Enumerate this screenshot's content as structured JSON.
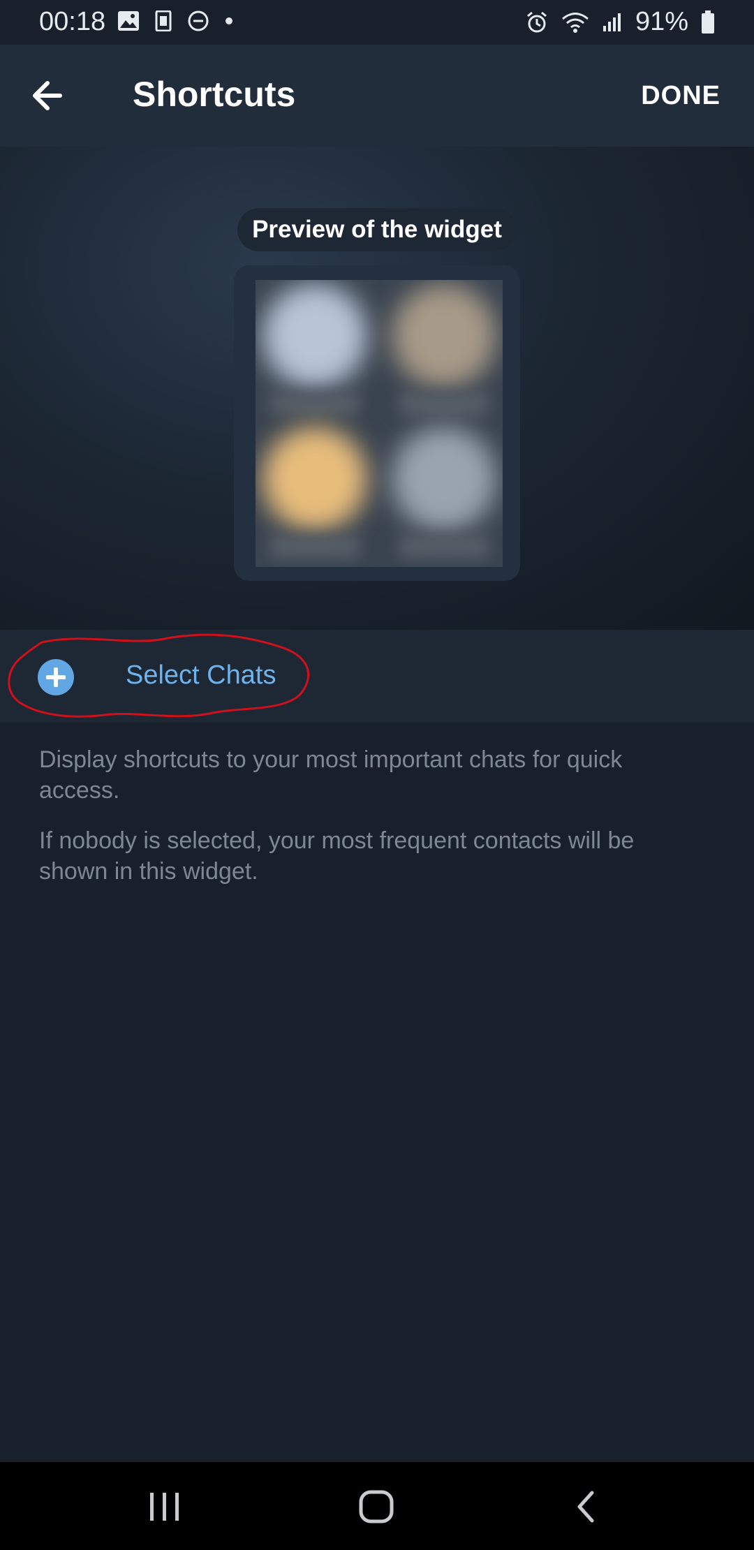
{
  "status_bar": {
    "time": "00:18",
    "battery": "91%",
    "left_icons": [
      "image-icon",
      "sim-icon",
      "dnd-icon",
      "dot-icon"
    ],
    "right_icons": [
      "alarm-icon",
      "wifi-icon",
      "signal-icon",
      "battery-icon"
    ]
  },
  "app_bar": {
    "back_icon": "arrow-left-icon",
    "title": "Shortcuts",
    "done_label": "DONE"
  },
  "preview": {
    "label": "Preview of the widget"
  },
  "select_chats": {
    "icon": "plus-circle-icon",
    "label": "Select Chats",
    "accent_color": "#62a7e3"
  },
  "info": {
    "line1": "Display shortcuts to your most important chats for quick access.",
    "line2": "If nobody is selected, your most frequent contacts will be shown in this widget."
  },
  "nav_bar": {
    "icons": [
      "recents-icon",
      "home-icon",
      "back-icon"
    ]
  },
  "colors": {
    "background": "#18202b",
    "app_bar": "#222d3b",
    "row": "#1e2835",
    "link": "#6db4ee",
    "annotation": "#d0101a"
  }
}
